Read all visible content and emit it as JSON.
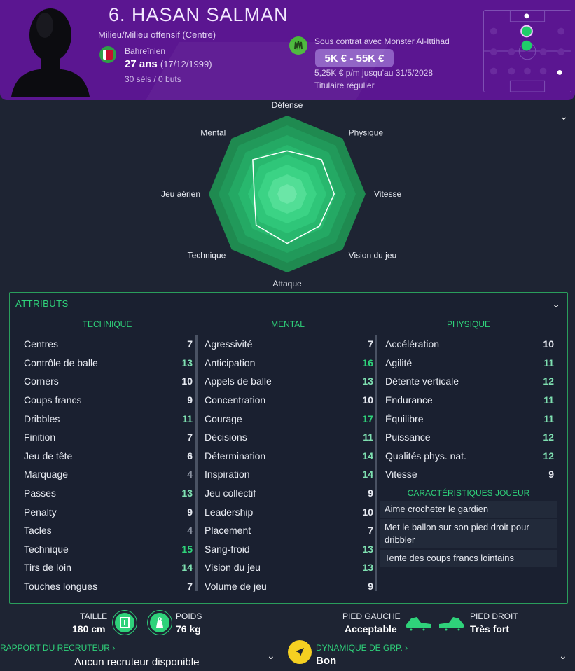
{
  "player": {
    "name": "6. HASAN SALMAN",
    "position": "Milieu/Milieu offensif (Centre)",
    "nationality": "Bahreïnien",
    "age": "27 ans",
    "dob": "(17/12/1999)",
    "caps": "30 séls / 0 buts",
    "contract": "Sous contrat avec Monster Al-Ittihad",
    "wage": "5K € - 55K €",
    "wage_note": "5,25K € p/m jusqu'au 31/5/2028",
    "status": "Titulaire régulier"
  },
  "radar": {
    "labels": [
      "Défense",
      "Physique",
      "Vitesse",
      "Vision du jeu",
      "Attaque",
      "Technique",
      "Jeu aérien",
      "Mental"
    ],
    "values": [
      0.55,
      0.62,
      0.6,
      0.58,
      0.63,
      0.56,
      0.42,
      0.62
    ]
  },
  "attributes": {
    "title": "ATTRIBUTS",
    "technique": {
      "header": "TECHNIQUE",
      "items": [
        {
          "name": "Centres",
          "value": "7"
        },
        {
          "name": "Contrôle de balle",
          "value": "13"
        },
        {
          "name": "Corners",
          "value": "10"
        },
        {
          "name": "Coups francs",
          "value": "9"
        },
        {
          "name": "Dribbles",
          "value": "11"
        },
        {
          "name": "Finition",
          "value": "7"
        },
        {
          "name": "Jeu de tête",
          "value": "6"
        },
        {
          "name": "Marquage",
          "value": "4"
        },
        {
          "name": "Passes",
          "value": "13"
        },
        {
          "name": "Penalty",
          "value": "9"
        },
        {
          "name": "Tacles",
          "value": "4"
        },
        {
          "name": "Technique",
          "value": "15"
        },
        {
          "name": "Tirs de loin",
          "value": "14"
        },
        {
          "name": "Touches longues",
          "value": "7"
        }
      ]
    },
    "mental": {
      "header": "MENTAL",
      "items": [
        {
          "name": "Agressivité",
          "value": "7"
        },
        {
          "name": "Anticipation",
          "value": "16"
        },
        {
          "name": "Appels de balle",
          "value": "13"
        },
        {
          "name": "Concentration",
          "value": "10"
        },
        {
          "name": "Courage",
          "value": "17"
        },
        {
          "name": "Décisions",
          "value": "11"
        },
        {
          "name": "Détermination",
          "value": "14"
        },
        {
          "name": "Inspiration",
          "value": "14"
        },
        {
          "name": "Jeu collectif",
          "value": "9"
        },
        {
          "name": "Leadership",
          "value": "10"
        },
        {
          "name": "Placement",
          "value": "7"
        },
        {
          "name": "Sang-froid",
          "value": "13"
        },
        {
          "name": "Vision du jeu",
          "value": "13"
        },
        {
          "name": "Volume de jeu",
          "value": "9"
        }
      ]
    },
    "physique": {
      "header": "PHYSIQUE",
      "items": [
        {
          "name": "Accélération",
          "value": "10"
        },
        {
          "name": "Agilité",
          "value": "11"
        },
        {
          "name": "Détente verticale",
          "value": "12"
        },
        {
          "name": "Endurance",
          "value": "11"
        },
        {
          "name": "Équilibre",
          "value": "11"
        },
        {
          "name": "Puissance",
          "value": "12"
        },
        {
          "name": "Qualités phys. nat.",
          "value": "12"
        },
        {
          "name": "Vitesse",
          "value": "9"
        }
      ]
    },
    "characteristics": {
      "header": "CARACTÉRISTIQUES JOUEUR",
      "items": [
        "Aime crocheter le gardien",
        "Met le ballon sur son pied droit pour dribbler",
        "Tente des coups francs lointains"
      ]
    }
  },
  "footer": {
    "height_label": "TAILLE",
    "height_value": "180 cm",
    "weight_label": "POIDS",
    "weight_value": "76 kg",
    "left_foot_label": "PIED GAUCHE",
    "left_foot_value": "Acceptable",
    "right_foot_label": "PIED DROIT",
    "right_foot_value": "Très fort",
    "scout_label": "RAPPORT DU RECRUTEUR ›",
    "scout_value": "Aucun recruteur disponible",
    "dyn_label": "DYNAMIQUE DE GRP. ›",
    "dyn_value": "Bon"
  },
  "colors": {
    "header_bg": "#5b1691",
    "accent_green": "#2fd27a",
    "value_white": "#e8ebf2",
    "value_grey": "#8a91a0"
  }
}
